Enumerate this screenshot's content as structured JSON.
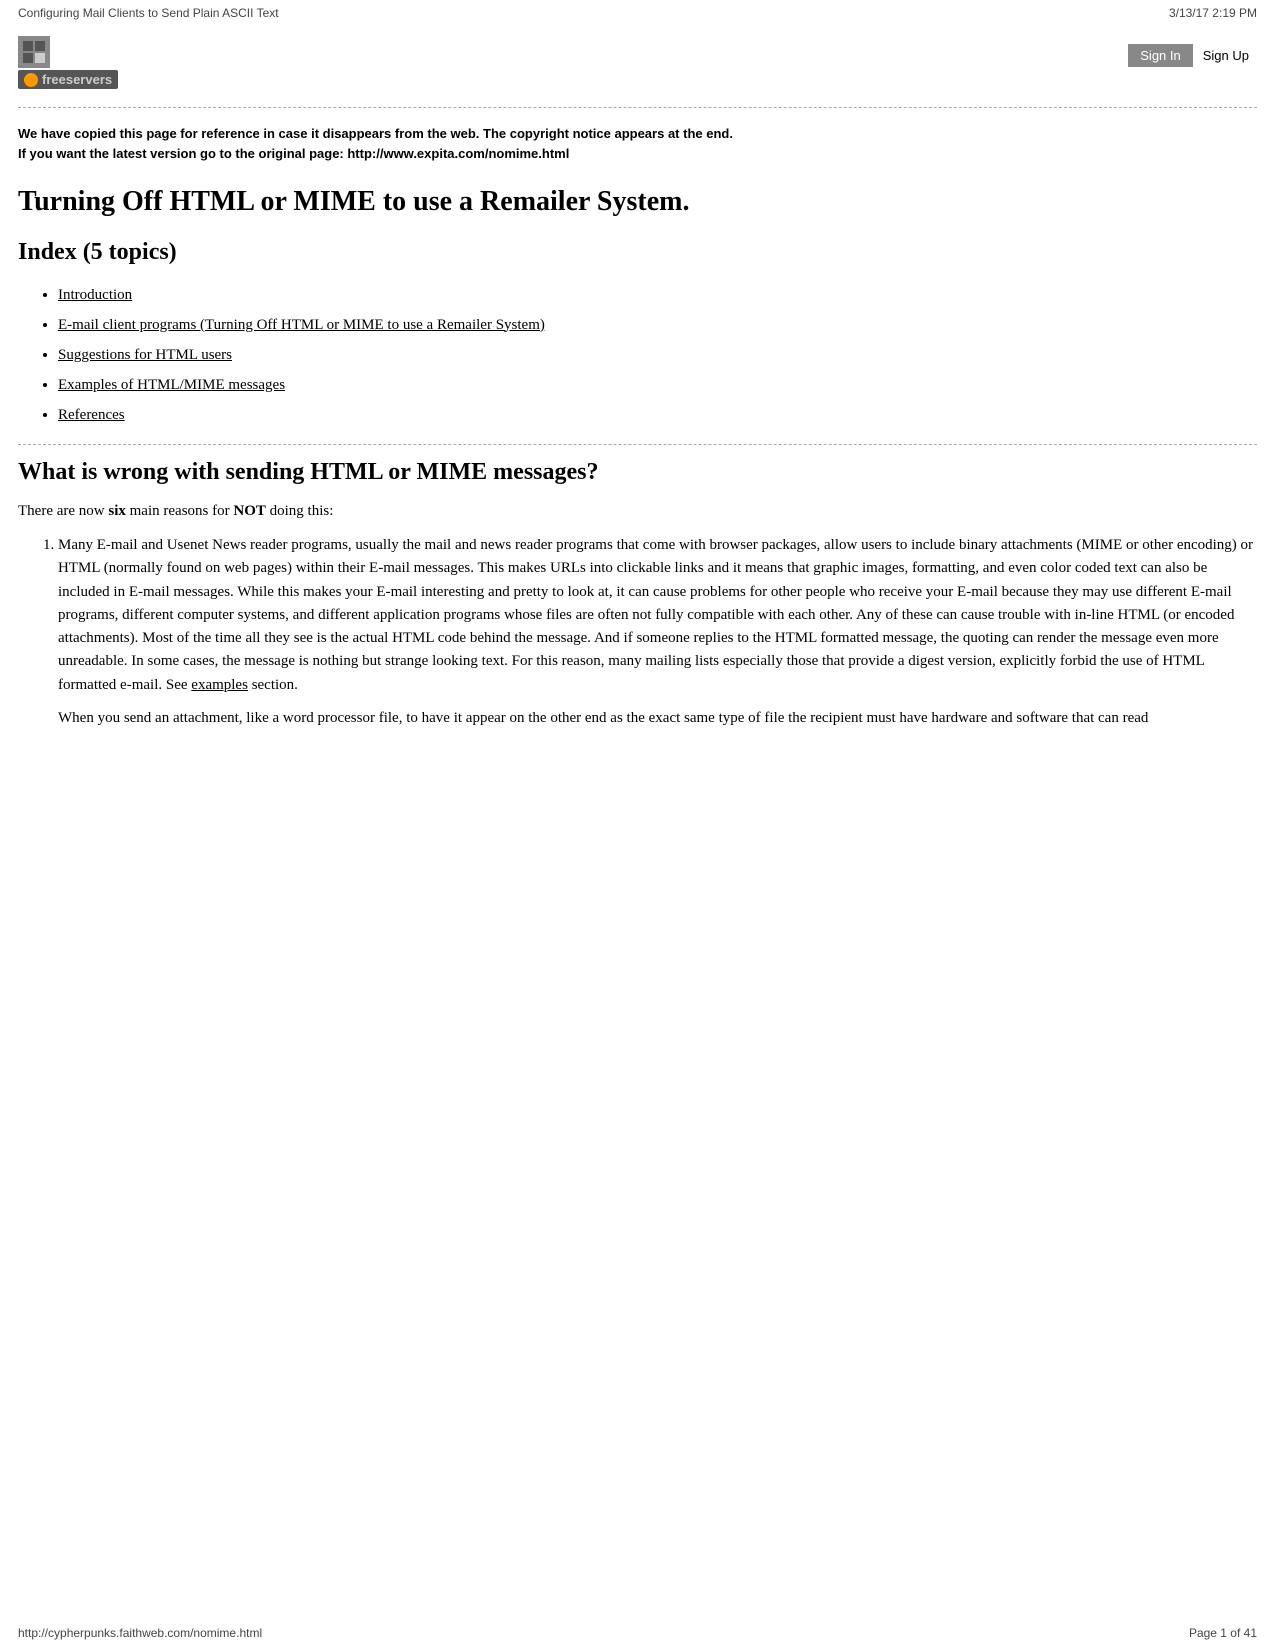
{
  "topbar": {
    "title": "Configuring Mail Clients to Send Plain ASCII Text",
    "date": "3/13/17 2:19 PM"
  },
  "logo": {
    "text": "freeservers",
    "icon_alt": "logo-icon"
  },
  "auth": {
    "sign_in": "Sign In",
    "sign_up": "Sign Up"
  },
  "notice": {
    "text": "We have copied this page for reference in case it disappears from the web. The copyright notice appears at the end.\nIf you want the latest version go to the original page: http://www.expita.com/nomime.html"
  },
  "page_title": "Turning Off HTML or MIME to use a Remailer System.",
  "index": {
    "heading": "Index (5 topics)",
    "items": [
      {
        "label": "Introduction",
        "href": "#introduction"
      },
      {
        "label": "E-mail client programs (Turning Off HTML or MIME to use a Remailer System)",
        "href": "#email-clients"
      },
      {
        "label": "Suggestions for HTML users",
        "href": "#suggestions"
      },
      {
        "label": "Examples of HTML/MIME messages",
        "href": "#examples"
      },
      {
        "label": "References",
        "href": "#references"
      }
    ]
  },
  "what_section": {
    "heading": "What is wrong with sending HTML or MIME messages?",
    "intro": "There are now six main reasons for NOT doing this:",
    "item1_text": "Many E-mail and Usenet News reader programs, usually the mail and news reader programs that come with browser packages, allow users to include binary attachments (MIME or other encoding) or HTML (normally found on web pages) within their E-mail messages. This makes URLs into clickable links and it means that graphic images, formatting, and even color coded text can also be included in E-mail messages. While this makes your E-mail interesting and pretty to look at, it can cause problems for other people who receive your E-mail because they may use different E-mail programs, different computer systems, and different application programs whose files are often not fully compatible with each other. Any of these can cause trouble with in-line HTML (or encoded attachments). Most of the time all they see is the actual HTML code behind the message. And if someone replies to the HTML formatted message, the quoting can render the message even more unreadable. In some cases, the message is nothing but strange looking text. For this reason, many mailing lists especially those that provide a digest version, explicitly forbid the use of HTML formatted e-mail. See examples section.",
    "item1_para2": "When you send an attachment, like a word processor file, to have it appear on the other end as the exact same type of file the recipient must have hardware and software that can read"
  },
  "footer": {
    "url": "http://cypherpunks.faithweb.com/nomime.html",
    "page": "Page 1 of 41"
  }
}
